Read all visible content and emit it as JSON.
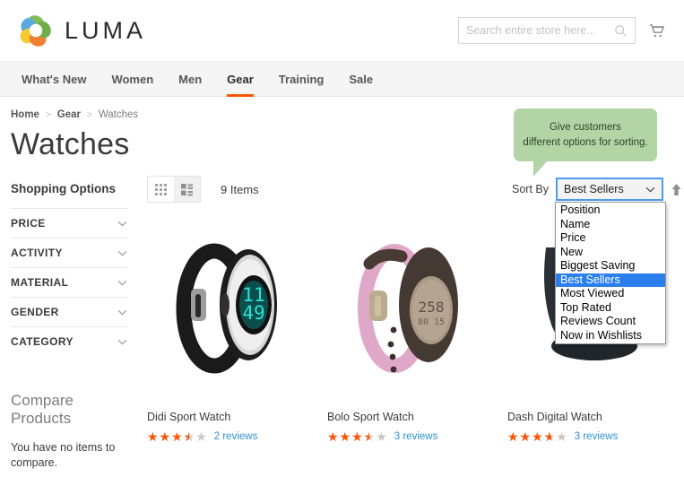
{
  "brand": {
    "name": "LUMA",
    "logo_icon": "luma-flower-logo"
  },
  "search": {
    "placeholder": "Search entire store here...",
    "value": "",
    "icon": "search-icon"
  },
  "cart": {
    "icon": "shopping-cart-icon"
  },
  "nav": {
    "items": [
      {
        "label": "What's New",
        "active": false
      },
      {
        "label": "Women",
        "active": false
      },
      {
        "label": "Men",
        "active": false
      },
      {
        "label": "Gear",
        "active": true
      },
      {
        "label": "Training",
        "active": false
      },
      {
        "label": "Sale",
        "active": false
      }
    ],
    "active_underline_color": "#ff5501"
  },
  "breadcrumb": {
    "items": [
      "Home",
      "Gear",
      "Watches"
    ],
    "separator": ">"
  },
  "page": {
    "title": "Watches"
  },
  "callout": {
    "line1": "Give customers",
    "line2": "different options for sorting.",
    "background": "#b3d4a5"
  },
  "sidebar": {
    "title": "Shopping Options",
    "filters": [
      {
        "label": "PRICE",
        "icon": "chevron-down-icon"
      },
      {
        "label": "ACTIVITY",
        "icon": "chevron-down-icon"
      },
      {
        "label": "MATERIAL",
        "icon": "chevron-down-icon"
      },
      {
        "label": "GENDER",
        "icon": "chevron-down-icon"
      },
      {
        "label": "CATEGORY",
        "icon": "chevron-down-icon"
      }
    ],
    "compare": {
      "title": "Compare Products",
      "empty_text": "You have no items to compare."
    }
  },
  "toolbar": {
    "view_grid_icon": "grid-view-icon",
    "view_list_icon": "list-view-icon",
    "active_view": "grid",
    "item_count": "9 Items",
    "sort_label": "Sort By",
    "sort_selected": "Best Sellers",
    "sort_caret_icon": "chevron-down-icon",
    "sort_direction_icon": "arrow-up-icon",
    "focus_ring_color": "#4c9ded",
    "sort_options": [
      {
        "label": "Position",
        "selected": false
      },
      {
        "label": "Name",
        "selected": false
      },
      {
        "label": "Price",
        "selected": false
      },
      {
        "label": "New",
        "selected": false
      },
      {
        "label": "Biggest Saving",
        "selected": false
      },
      {
        "label": "Best Sellers",
        "selected": true
      },
      {
        "label": "Most Viewed",
        "selected": false
      },
      {
        "label": "Top Rated",
        "selected": false
      },
      {
        "label": "Reviews Count",
        "selected": false
      },
      {
        "label": "Now in Wishlists",
        "selected": false
      }
    ],
    "highlight_color": "#2a7fed"
  },
  "products": [
    {
      "name": "Didi Sport Watch",
      "rating_percent": 70,
      "reviews": "2 reviews",
      "image": "black-silver-sport-watch",
      "display": "11 49"
    },
    {
      "name": "Bolo Sport Watch",
      "rating_percent": 70,
      "reviews": "3 reviews",
      "image": "pink-brown-sport-watch",
      "display": "258"
    },
    {
      "name": "Dash Digital Watch",
      "rating_percent": 72,
      "reviews": "3 reviews",
      "image": "black-digital-watch",
      "display": ""
    }
  ],
  "star_glyphs": "★★★★★",
  "colors": {
    "accent": "#ff5501",
    "link": "#2e8fd8",
    "star": "#ff5501"
  }
}
